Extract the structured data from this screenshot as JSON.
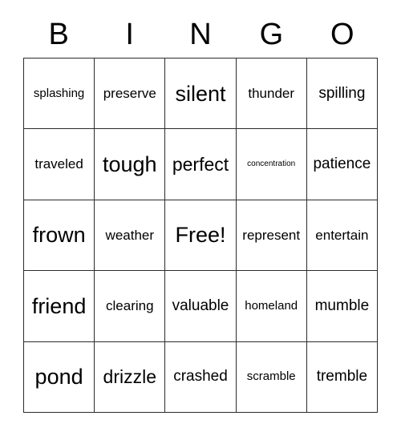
{
  "card": {
    "title": "BINGO",
    "header_letters": [
      "B",
      "I",
      "N",
      "G",
      "O"
    ],
    "free_space_label": "Free!",
    "grid_size": "5x5",
    "border_color": "#2b2b2b",
    "background_color": "#ffffff",
    "text_color": "#000000",
    "rows": [
      [
        {
          "text": "splashing",
          "size": "s"
        },
        {
          "text": "preserve",
          "size": "m"
        },
        {
          "text": "silent",
          "size": "xxl"
        },
        {
          "text": "thunder",
          "size": "m"
        },
        {
          "text": "spilling",
          "size": "l"
        }
      ],
      [
        {
          "text": "traveled",
          "size": "m"
        },
        {
          "text": "tough",
          "size": "xxl"
        },
        {
          "text": "perfect",
          "size": "xl"
        },
        {
          "text": "concentration",
          "size": "xs"
        },
        {
          "text": "patience",
          "size": "l"
        }
      ],
      [
        {
          "text": "frown",
          "size": "xxl"
        },
        {
          "text": "weather",
          "size": "m"
        },
        {
          "text": "Free!",
          "size": "xxl"
        },
        {
          "text": "represent",
          "size": "m"
        },
        {
          "text": "entertain",
          "size": "m"
        }
      ],
      [
        {
          "text": "friend",
          "size": "xxl"
        },
        {
          "text": "clearing",
          "size": "m"
        },
        {
          "text": "valuable",
          "size": "l"
        },
        {
          "text": "homeland",
          "size": "s"
        },
        {
          "text": "mumble",
          "size": "l"
        }
      ],
      [
        {
          "text": "pond",
          "size": "xxl"
        },
        {
          "text": "drizzle",
          "size": "xl"
        },
        {
          "text": "crashed",
          "size": "l"
        },
        {
          "text": "scramble",
          "size": "s"
        },
        {
          "text": "tremble",
          "size": "l"
        }
      ]
    ]
  }
}
